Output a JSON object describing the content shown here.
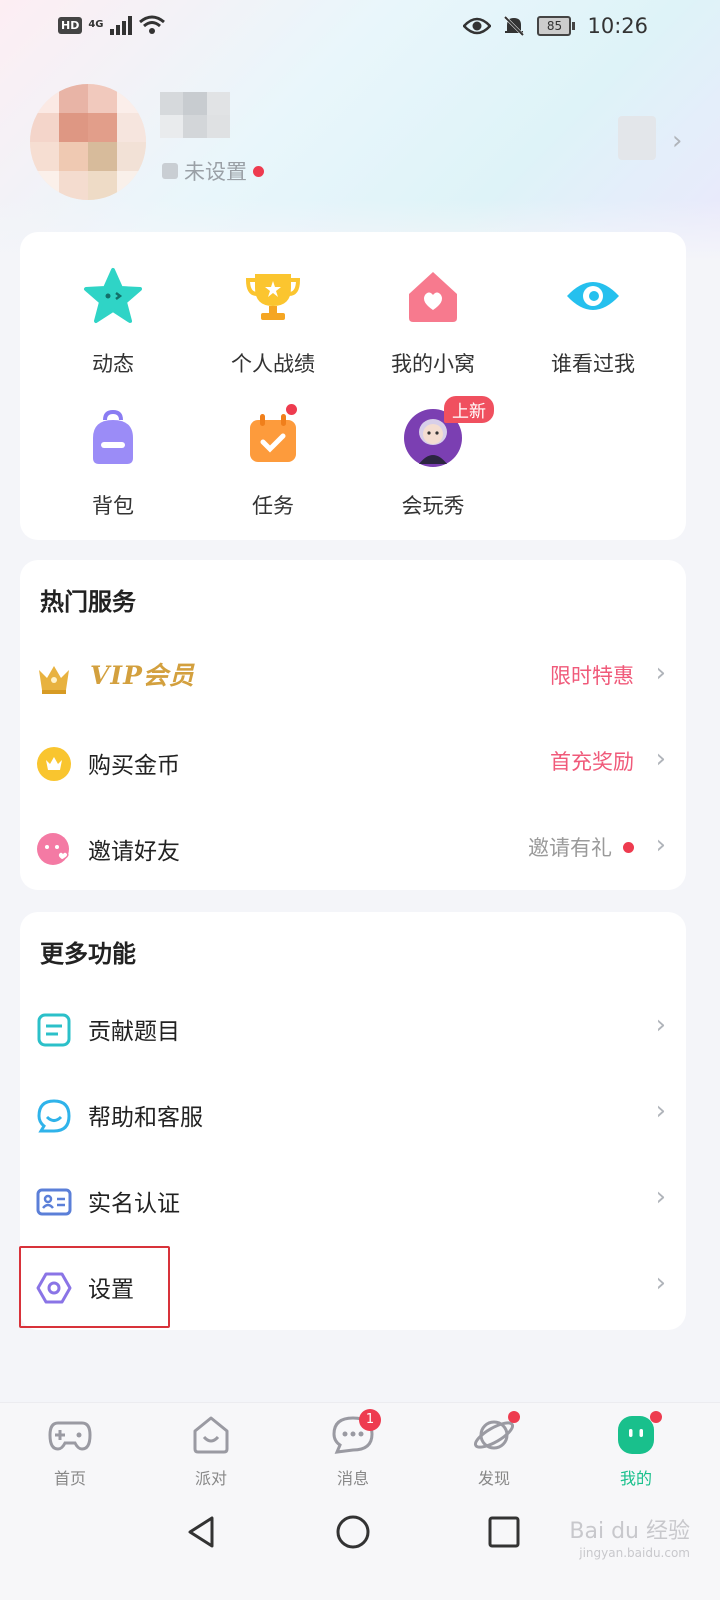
{
  "status_bar": {
    "hd": "HD",
    "network": "4G",
    "battery": "85",
    "time": "10:26"
  },
  "profile": {
    "nickname_hint": "未设置"
  },
  "grid": {
    "items": [
      {
        "label": "动态",
        "icon": "star-face-icon"
      },
      {
        "label": "个人战绩",
        "icon": "trophy-icon"
      },
      {
        "label": "我的小窝",
        "icon": "home-heart-icon"
      },
      {
        "label": "谁看过我",
        "icon": "eye-icon"
      },
      {
        "label": "背包",
        "icon": "backpack-icon"
      },
      {
        "label": "任务",
        "icon": "task-calendar-icon"
      },
      {
        "label": "会玩秀",
        "icon": "avatar-show-icon"
      }
    ],
    "new_tag": "上新"
  },
  "hot_services": {
    "title": "热门服务",
    "rows": [
      {
        "label": "VIP会员",
        "right": "限时特惠"
      },
      {
        "label": "购买金币",
        "right": "首充奖励"
      },
      {
        "label": "邀请好友",
        "right": "邀请有礼"
      }
    ]
  },
  "more": {
    "title": "更多功能",
    "rows": [
      {
        "label": "贡献题目"
      },
      {
        "label": "帮助和客服"
      },
      {
        "label": "实名认证"
      },
      {
        "label": "设置"
      }
    ]
  },
  "tabbar": {
    "tabs": [
      {
        "label": "首页"
      },
      {
        "label": "派对"
      },
      {
        "label": "消息",
        "badge": "1"
      },
      {
        "label": "发现"
      },
      {
        "label": "我的"
      }
    ]
  },
  "watermark": {
    "main": "Bai du 经验",
    "sub": "jingyan.baidu.com"
  },
  "colors": {
    "accent": "#19c08c",
    "pink": "#f05a7a",
    "badge": "#ee3b4f",
    "highlight": "#d8323a"
  }
}
